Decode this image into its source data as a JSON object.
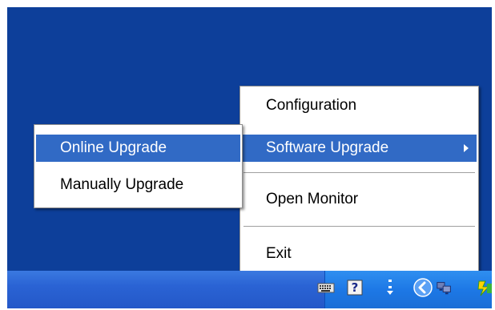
{
  "main_menu": {
    "items": [
      {
        "label": "Configuration"
      },
      {
        "label": "Software Upgrade"
      },
      {
        "label": "Open Monitor"
      },
      {
        "label": "Exit"
      }
    ]
  },
  "submenu": {
    "items": [
      {
        "label": "Online Upgrade"
      },
      {
        "label": "Manually Upgrade"
      }
    ]
  },
  "tray": {
    "icons": [
      "keyboard-icon",
      "help-icon",
      "usb-icon",
      "back-arrow-icon",
      "network-icon",
      "app-icon"
    ],
    "help_glyph": "?"
  },
  "colors": {
    "desktop": "#0d3f9a",
    "highlight": "#316ac5",
    "taskbar": "#2a63d4"
  }
}
